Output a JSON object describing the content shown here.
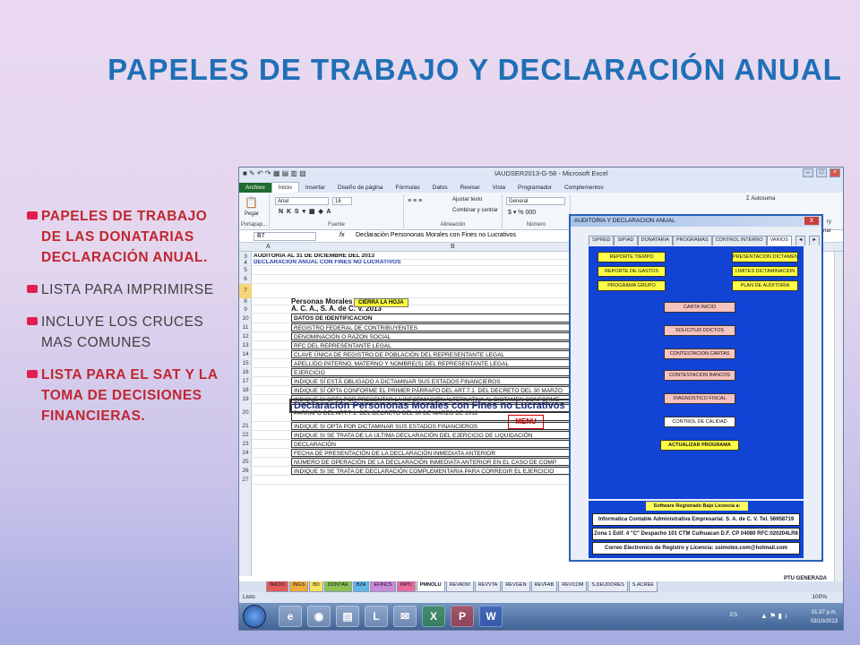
{
  "slide": {
    "title": "PAPELES DE TRABAJO Y DECLARACIÓN ANUAL",
    "bullets": [
      {
        "text": "PAPELES DE TRABAJO DE LAS DONATARIAS DECLARACIÓN ANUAL.",
        "style": "red"
      },
      {
        "text": "LISTA PARA IMPRIMIRSE",
        "style": "gray"
      },
      {
        "text": "INCLUYE LOS CRUCES MAS COMUNES",
        "style": "gray"
      },
      {
        "text": "LISTA PARA EL SAT Y LA TOMA DE DECISIONES FINANCIERAS.",
        "style": "red"
      }
    ],
    "colors": {
      "title": "#1f6fb6",
      "bullet_red": "#c0262f",
      "bullet_gray": "#404040",
      "bullet_mark": "#e01f4f"
    }
  },
  "excel": {
    "window_title": "IAUDSER2013-G-58 - Microsoft Excel",
    "ribbon_tabs": [
      "Archivo",
      "Inicio",
      "Insertar",
      "Diseño de página",
      "Fórmulas",
      "Datos",
      "Revisar",
      "Vista",
      "Programador",
      "Complementos"
    ],
    "ribbon": {
      "font_name": "Arial",
      "font_size": "16",
      "wrap_text": "Ajustar texto",
      "merge": "Combinar y centrar",
      "number_format": "General",
      "autosum": "Autosuma",
      "paste": "Pegar",
      "groups": [
        "Portapap...",
        "Fuente",
        "Alineación",
        "Número"
      ]
    },
    "name_box": "B7",
    "fx": "fx",
    "formula": "Declaración Persononas Morales con Fines no Lucrativos",
    "columns": [
      "A",
      "B"
    ],
    "rows": [
      {
        "n": "3",
        "text": "AUDITORIA AL 31 DE DICIEMBRE DEL 2013",
        "kind": "bold"
      },
      {
        "n": "4",
        "text": "DECLARACION ANUAL CON FINES NO LUCRATIVOS",
        "kind": "blue"
      },
      {
        "n": "5",
        "text": "",
        "kind": ""
      },
      {
        "n": "6",
        "text": "",
        "kind": ""
      },
      {
        "n": "7",
        "text": "",
        "kind": "hl"
      },
      {
        "n": "8",
        "text": "Personas Morales",
        "kind": "bold"
      },
      {
        "n": "9",
        "text": "A. C. A., S. A. de C. V. 2013",
        "kind": "bold"
      },
      {
        "n": "10",
        "text": "DATOS DE IDENTIFICACION",
        "kind": "boxbold"
      },
      {
        "n": "11",
        "text": "REGISTRO FEDERAL DE CONTRIBUYENTES",
        "kind": "box"
      },
      {
        "n": "12",
        "text": "DENOMINACIÓN O RAZON SOCIAL",
        "kind": "box"
      },
      {
        "n": "13",
        "text": "RFC DEL REPRESENTANTE LEGAL",
        "kind": "box"
      },
      {
        "n": "14",
        "text": "CLAVE ÚNICA DE REGISTRO DE POBLACIÓN DEL REPRESENTANTE LEGAL",
        "kind": "box"
      },
      {
        "n": "15",
        "text": "APELLIDO PATERNO, MATERNO Y NOMBRE(S) DEL REPRESENTANTE LEGAL",
        "kind": "box"
      },
      {
        "n": "16",
        "text": "EJERCICIO",
        "kind": "box"
      },
      {
        "n": "17",
        "text": "INDIQUE SÍ ESTÁ OBLIGADO A DICTAMINAR SUS ESTADOS FINANCIEROS",
        "kind": "box"
      },
      {
        "n": "18",
        "text": "INDIQUE SÍ OPTA CONFORME EL PRIMER PÁRRAFO DEL ART.7.1. DEL DECRETO DEL 30 MARZO",
        "kind": "box"
      },
      {
        "n": "19",
        "text": "INDIQUE SI OPTA POR PRESENTAR LA INFORMACIÓN ALTERNATIVA AL DICTAMEN CONFORME",
        "kind": "box2"
      },
      {
        "n": "20",
        "text": "PARRAFO DEL ART.7.1. DEL DECRETO DEL 30 DE MARZO DE 2012",
        "kind": "box"
      },
      {
        "n": "21",
        "text": "INDIQUE SI OPTA POR DICTAMINAR SUS ESTADOS FINANCIEROS",
        "kind": "box"
      },
      {
        "n": "22",
        "text": "INDIQUE SI SE TRATA DE LA ÚLTIMA DECLARACIÓN DEL EJERCICIO DE LIQUIDACIÓN",
        "kind": "box"
      },
      {
        "n": "23",
        "text": "DECLARACIÓN",
        "kind": "box"
      },
      {
        "n": "24",
        "text": "FECHA DE PRESENTACIÓN DE LA DECLARACIÓN INMEDIATA ANTERIOR",
        "kind": "box"
      },
      {
        "n": "25",
        "text": "NÚMERO DE OPERACIÓN DE LA DECLARACIÓN INMEDIATA ANTERIOR EN EL CASO DE COMP",
        "kind": "box"
      },
      {
        "n": "26",
        "text": "INDIQUE SI SE TRATA DE DECLARACIÓN COMPLEMENTARIA PARA CORREGIR EL EJERCICIO",
        "kind": "box"
      },
      {
        "n": "27",
        "text": "",
        "kind": ""
      }
    ],
    "cierra_hoja": "CIERRA LA HOJA",
    "declaration_heading": "Declaración Persononas Morales con Fines no Lucrativos",
    "menu": "MENU",
    "dialog": {
      "title": "AUDITORIA Y DECLARACION ANUAL",
      "close": "X",
      "tabs": [
        "SIPRED",
        "SIPIAD",
        "DONATARIA",
        "PROGRAMAS",
        "CONTROL INTERNO",
        "VARIOS"
      ],
      "active_tab": "VARIOS",
      "tab_arrows": [
        "◄",
        "►"
      ],
      "left_buttons": [
        "REPORTE TIEMPO",
        "REPORTE DE GASTOS",
        "PROGRAMA GRUPO"
      ],
      "right_buttons": [
        "PRESENTACION DICTAMEN",
        "LIMITES DICTAMINACION",
        "PLAN DE AUDITORIA"
      ],
      "center_buttons": [
        "CARTA INICIO",
        "SOLICITUD DOCTOS",
        "CONTESTACION CARTAS",
        "CONTESTACION BANCOS",
        "DIAGNOSTICO FISCAL",
        "CONTROL DE CALIDAD"
      ],
      "update_button": "ACTUALIZAR PROGRAMA",
      "license_header": "Software Registrado Bajo Licencia a:",
      "license_lines": [
        "Informatica Contable Administrativa Empresarial. S. A. de C. V. Tel. 56958719",
        "Zona 1 Edif. 4 \"C\" Despacho 101 CTM Culhuacan D.F. CP 04080 RFC:020204LR8",
        "Correo Electronico de Registro y Licencia: ssimolex.com@hotmail.com"
      ]
    },
    "right_fragments": [
      "ry",
      "nar",
      "PTU GENERADA"
    ],
    "sheet_tabs": [
      "INICIO",
      "INGS",
      "BD",
      "DONTAR",
      "BZA",
      "EFINCS",
      "INPC",
      "PMNOLU",
      "REVADM",
      "REVVTA",
      "REVGEN",
      "REVFAB",
      "REVCOM",
      "S.DEUDORES",
      "S.ACREE"
    ],
    "active_sheet": "PMNOLU",
    "status_left": "Listo",
    "zoom": "100%",
    "taskbar": {
      "icons": [
        "ie",
        "chrome",
        "explorer",
        "lync",
        "mail",
        "excel",
        "pdf",
        "word"
      ],
      "lang": "ES",
      "time": "01:37 p.m.",
      "date": "03/10/2013"
    }
  }
}
